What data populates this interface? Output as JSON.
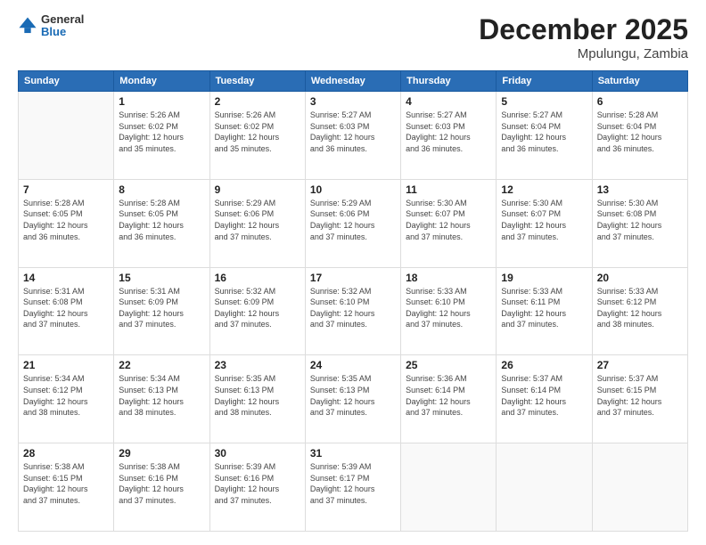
{
  "logo": {
    "general": "General",
    "blue": "Blue"
  },
  "title": {
    "month_year": "December 2025",
    "location": "Mpulungu, Zambia"
  },
  "weekdays": [
    "Sunday",
    "Monday",
    "Tuesday",
    "Wednesday",
    "Thursday",
    "Friday",
    "Saturday"
  ],
  "weeks": [
    [
      {
        "day": "",
        "info": ""
      },
      {
        "day": "1",
        "info": "Sunrise: 5:26 AM\nSunset: 6:02 PM\nDaylight: 12 hours\nand 35 minutes."
      },
      {
        "day": "2",
        "info": "Sunrise: 5:26 AM\nSunset: 6:02 PM\nDaylight: 12 hours\nand 35 minutes."
      },
      {
        "day": "3",
        "info": "Sunrise: 5:27 AM\nSunset: 6:03 PM\nDaylight: 12 hours\nand 36 minutes."
      },
      {
        "day": "4",
        "info": "Sunrise: 5:27 AM\nSunset: 6:03 PM\nDaylight: 12 hours\nand 36 minutes."
      },
      {
        "day": "5",
        "info": "Sunrise: 5:27 AM\nSunset: 6:04 PM\nDaylight: 12 hours\nand 36 minutes."
      },
      {
        "day": "6",
        "info": "Sunrise: 5:28 AM\nSunset: 6:04 PM\nDaylight: 12 hours\nand 36 minutes."
      }
    ],
    [
      {
        "day": "7",
        "info": "Sunrise: 5:28 AM\nSunset: 6:05 PM\nDaylight: 12 hours\nand 36 minutes."
      },
      {
        "day": "8",
        "info": "Sunrise: 5:28 AM\nSunset: 6:05 PM\nDaylight: 12 hours\nand 36 minutes."
      },
      {
        "day": "9",
        "info": "Sunrise: 5:29 AM\nSunset: 6:06 PM\nDaylight: 12 hours\nand 37 minutes."
      },
      {
        "day": "10",
        "info": "Sunrise: 5:29 AM\nSunset: 6:06 PM\nDaylight: 12 hours\nand 37 minutes."
      },
      {
        "day": "11",
        "info": "Sunrise: 5:30 AM\nSunset: 6:07 PM\nDaylight: 12 hours\nand 37 minutes."
      },
      {
        "day": "12",
        "info": "Sunrise: 5:30 AM\nSunset: 6:07 PM\nDaylight: 12 hours\nand 37 minutes."
      },
      {
        "day": "13",
        "info": "Sunrise: 5:30 AM\nSunset: 6:08 PM\nDaylight: 12 hours\nand 37 minutes."
      }
    ],
    [
      {
        "day": "14",
        "info": "Sunrise: 5:31 AM\nSunset: 6:08 PM\nDaylight: 12 hours\nand 37 minutes."
      },
      {
        "day": "15",
        "info": "Sunrise: 5:31 AM\nSunset: 6:09 PM\nDaylight: 12 hours\nand 37 minutes."
      },
      {
        "day": "16",
        "info": "Sunrise: 5:32 AM\nSunset: 6:09 PM\nDaylight: 12 hours\nand 37 minutes."
      },
      {
        "day": "17",
        "info": "Sunrise: 5:32 AM\nSunset: 6:10 PM\nDaylight: 12 hours\nand 37 minutes."
      },
      {
        "day": "18",
        "info": "Sunrise: 5:33 AM\nSunset: 6:10 PM\nDaylight: 12 hours\nand 37 minutes."
      },
      {
        "day": "19",
        "info": "Sunrise: 5:33 AM\nSunset: 6:11 PM\nDaylight: 12 hours\nand 37 minutes."
      },
      {
        "day": "20",
        "info": "Sunrise: 5:33 AM\nSunset: 6:12 PM\nDaylight: 12 hours\nand 38 minutes."
      }
    ],
    [
      {
        "day": "21",
        "info": "Sunrise: 5:34 AM\nSunset: 6:12 PM\nDaylight: 12 hours\nand 38 minutes."
      },
      {
        "day": "22",
        "info": "Sunrise: 5:34 AM\nSunset: 6:13 PM\nDaylight: 12 hours\nand 38 minutes."
      },
      {
        "day": "23",
        "info": "Sunrise: 5:35 AM\nSunset: 6:13 PM\nDaylight: 12 hours\nand 38 minutes."
      },
      {
        "day": "24",
        "info": "Sunrise: 5:35 AM\nSunset: 6:13 PM\nDaylight: 12 hours\nand 37 minutes."
      },
      {
        "day": "25",
        "info": "Sunrise: 5:36 AM\nSunset: 6:14 PM\nDaylight: 12 hours\nand 37 minutes."
      },
      {
        "day": "26",
        "info": "Sunrise: 5:37 AM\nSunset: 6:14 PM\nDaylight: 12 hours\nand 37 minutes."
      },
      {
        "day": "27",
        "info": "Sunrise: 5:37 AM\nSunset: 6:15 PM\nDaylight: 12 hours\nand 37 minutes."
      }
    ],
    [
      {
        "day": "28",
        "info": "Sunrise: 5:38 AM\nSunset: 6:15 PM\nDaylight: 12 hours\nand 37 minutes."
      },
      {
        "day": "29",
        "info": "Sunrise: 5:38 AM\nSunset: 6:16 PM\nDaylight: 12 hours\nand 37 minutes."
      },
      {
        "day": "30",
        "info": "Sunrise: 5:39 AM\nSunset: 6:16 PM\nDaylight: 12 hours\nand 37 minutes."
      },
      {
        "day": "31",
        "info": "Sunrise: 5:39 AM\nSunset: 6:17 PM\nDaylight: 12 hours\nand 37 minutes."
      },
      {
        "day": "",
        "info": ""
      },
      {
        "day": "",
        "info": ""
      },
      {
        "day": "",
        "info": ""
      }
    ]
  ]
}
